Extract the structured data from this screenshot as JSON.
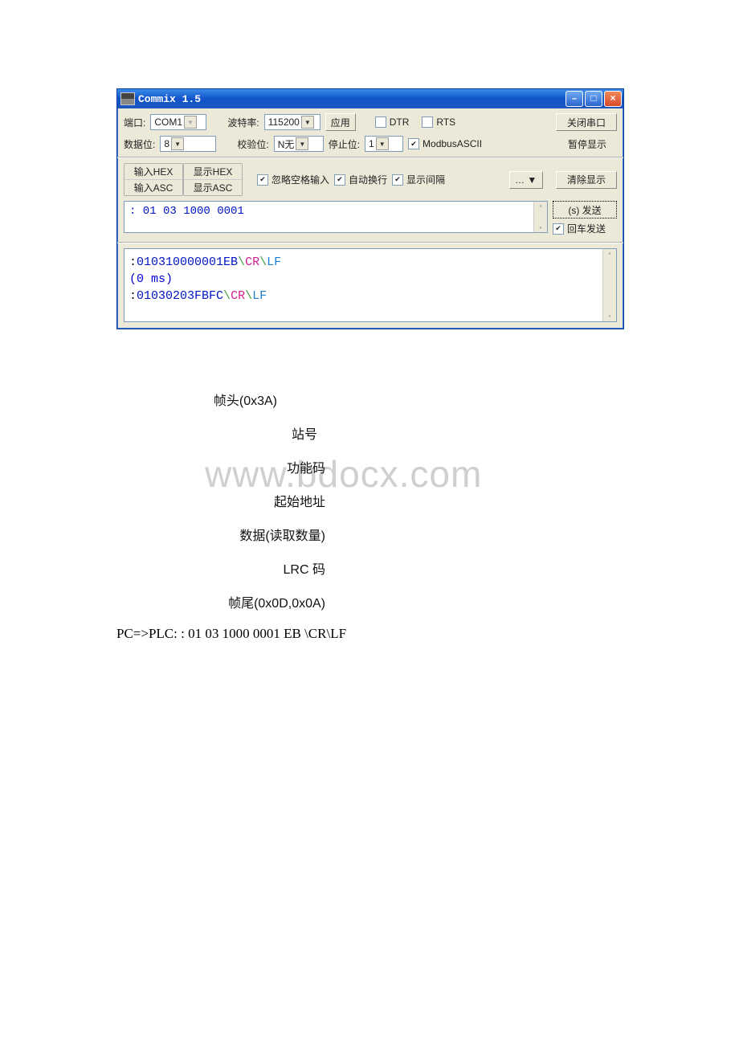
{
  "window": {
    "title": "Commix 1.5"
  },
  "row1": {
    "port_lbl": "端口:",
    "port_val": "COM1",
    "baud_lbl": "波特率:",
    "baud_val": "115200",
    "apply_btn": "应用",
    "dtr_lbl": "DTR",
    "rts_lbl": "RTS",
    "close_btn": "关闭串口"
  },
  "row2": {
    "data_lbl": "数据位:",
    "data_val": "8",
    "parity_lbl": "校验位:",
    "parity_val": "N无",
    "stop_lbl": "停止位:",
    "stop_val": "1",
    "modbus_lbl": "ModbusASCII",
    "pause_btn": "暂停显示"
  },
  "toggles": {
    "hex_in": "输入HEX",
    "hex_show": "显示HEX",
    "asc_in": "输入ASC",
    "asc_show": "显示ASC"
  },
  "row3": {
    "ignore_lbl": "忽略空格输入",
    "wrap_lbl": "自动换行",
    "interval_lbl": "显示间隔",
    "more_btn": "… ▼",
    "clear_btn": "清除显示"
  },
  "input": {
    "text": ": 01 03 1000 0001"
  },
  "send": {
    "btn": "(s) 发送",
    "enter_lbl": "回车发送"
  },
  "output": {
    "line1_data": "010310000001EB",
    "line1_cr": "CR",
    "line1_lf": "LF",
    "line2": "(0 ms)",
    "line3_data": "01030203FBFC",
    "line3_cr": "CR",
    "line3_lf": "LF"
  },
  "annotations": {
    "l1": "帧头(0x3A)",
    "l2": "站号",
    "l3": "功能码",
    "l4": "起始地址",
    "l5": "数据(读取数量)",
    "l6": "LRC 码",
    "l7": "帧尾(0x0D,0x0A)"
  },
  "watermark": "www.bdocx.com",
  "transmit": "PC=>PLC:   : 01 03 1000 0001 EB \\CR\\LF"
}
